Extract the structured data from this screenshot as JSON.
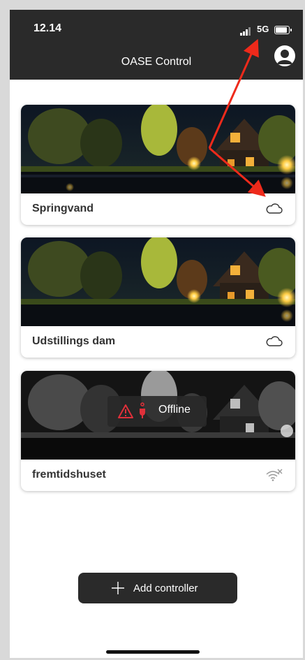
{
  "status_bar": {
    "time": "12.14",
    "network": "5G"
  },
  "app_bar": {
    "title": "OASE Control",
    "icon": "account-circle-icon"
  },
  "controllers": [
    {
      "name": "Springvand",
      "status_icon": "cloud-icon"
    },
    {
      "name": "Udstillings dam",
      "status_icon": "cloud-icon"
    },
    {
      "name": "fremtidshuset",
      "status_icon": "wifi-off-icon",
      "overlay_text": "Offline",
      "overlay_icons": [
        "warning-icon",
        "plug-icon"
      ]
    }
  ],
  "add_button": {
    "label": "Add controller",
    "icon": "plus-icon"
  },
  "colors": {
    "bar": "#2a2a2a",
    "warning": "#e0303a",
    "annotation": "#ee2a1b"
  }
}
